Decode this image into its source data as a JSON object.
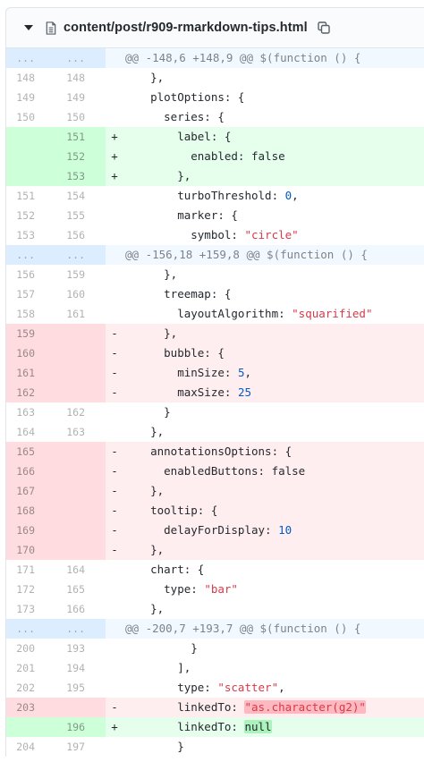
{
  "file": {
    "path": "content/post/r909-rmarkdown-tips.html",
    "collapse_icon": "caret-down-icon",
    "type_icon": "file-code-icon",
    "copy_icon": "copy-icon"
  },
  "colors": {
    "added_bg": "#e6ffed",
    "added_num_bg": "#cdffd8",
    "deleted_bg": "#ffeef0",
    "deleted_num_bg": "#ffdce0",
    "hunk_bg": "#f1f8ff",
    "hunk_num_bg": "#dbedff"
  },
  "lines": [
    {
      "type": "hunk",
      "old": "...",
      "new": "...",
      "sign": "",
      "parts": [
        {
          "t": "@@ -148,6 +148,9 @@ $(function () {",
          "c": ""
        }
      ]
    },
    {
      "type": "ctx",
      "old": "148",
      "new": "148",
      "sign": "",
      "parts": [
        {
          "t": "    },",
          "c": ""
        }
      ]
    },
    {
      "type": "ctx",
      "old": "149",
      "new": "149",
      "sign": "",
      "parts": [
        {
          "t": "    plotOptions: {",
          "c": ""
        }
      ]
    },
    {
      "type": "ctx",
      "old": "150",
      "new": "150",
      "sign": "",
      "parts": [
        {
          "t": "      series: {",
          "c": ""
        }
      ]
    },
    {
      "type": "add",
      "old": "",
      "new": "151",
      "sign": "+",
      "parts": [
        {
          "t": "        label: {",
          "c": ""
        }
      ]
    },
    {
      "type": "add",
      "old": "",
      "new": "152",
      "sign": "+",
      "parts": [
        {
          "t": "          enabled: ",
          "c": ""
        },
        {
          "t": "false",
          "c": "t-kw"
        }
      ]
    },
    {
      "type": "add",
      "old": "",
      "new": "153",
      "sign": "+",
      "parts": [
        {
          "t": "        },",
          "c": ""
        }
      ]
    },
    {
      "type": "ctx",
      "old": "151",
      "new": "154",
      "sign": "",
      "parts": [
        {
          "t": "        turboThreshold: ",
          "c": ""
        },
        {
          "t": "0",
          "c": "t-num"
        },
        {
          "t": ",",
          "c": ""
        }
      ]
    },
    {
      "type": "ctx",
      "old": "152",
      "new": "155",
      "sign": "",
      "parts": [
        {
          "t": "        marker: {",
          "c": ""
        }
      ]
    },
    {
      "type": "ctx",
      "old": "153",
      "new": "156",
      "sign": "",
      "parts": [
        {
          "t": "          symbol: ",
          "c": ""
        },
        {
          "t": "\"circle\"",
          "c": "t-str"
        }
      ]
    },
    {
      "type": "hunk",
      "old": "...",
      "new": "...",
      "sign": "",
      "parts": [
        {
          "t": "@@ -156,18 +159,8 @@ $(function () {",
          "c": ""
        }
      ]
    },
    {
      "type": "ctx",
      "old": "156",
      "new": "159",
      "sign": "",
      "parts": [
        {
          "t": "      },",
          "c": ""
        }
      ]
    },
    {
      "type": "ctx",
      "old": "157",
      "new": "160",
      "sign": "",
      "parts": [
        {
          "t": "      treemap: {",
          "c": ""
        }
      ]
    },
    {
      "type": "ctx",
      "old": "158",
      "new": "161",
      "sign": "",
      "parts": [
        {
          "t": "        layoutAlgorithm: ",
          "c": ""
        },
        {
          "t": "\"squarified\"",
          "c": "t-str"
        }
      ]
    },
    {
      "type": "del",
      "old": "159",
      "new": "",
      "sign": "-",
      "parts": [
        {
          "t": "      },",
          "c": ""
        }
      ]
    },
    {
      "type": "del",
      "old": "160",
      "new": "",
      "sign": "-",
      "parts": [
        {
          "t": "      bubble: {",
          "c": ""
        }
      ]
    },
    {
      "type": "del",
      "old": "161",
      "new": "",
      "sign": "-",
      "parts": [
        {
          "t": "        minSize: ",
          "c": ""
        },
        {
          "t": "5",
          "c": "t-num"
        },
        {
          "t": ",",
          "c": ""
        }
      ]
    },
    {
      "type": "del",
      "old": "162",
      "new": "",
      "sign": "-",
      "parts": [
        {
          "t": "        maxSize: ",
          "c": ""
        },
        {
          "t": "25",
          "c": "t-num"
        }
      ]
    },
    {
      "type": "ctx",
      "old": "163",
      "new": "162",
      "sign": "",
      "parts": [
        {
          "t": "      }",
          "c": ""
        }
      ]
    },
    {
      "type": "ctx",
      "old": "164",
      "new": "163",
      "sign": "",
      "parts": [
        {
          "t": "    },",
          "c": ""
        }
      ]
    },
    {
      "type": "del",
      "old": "165",
      "new": "",
      "sign": "-",
      "parts": [
        {
          "t": "    annotationsOptions: {",
          "c": ""
        }
      ]
    },
    {
      "type": "del",
      "old": "166",
      "new": "",
      "sign": "-",
      "parts": [
        {
          "t": "      enabledButtons: ",
          "c": ""
        },
        {
          "t": "false",
          "c": "t-kw"
        }
      ]
    },
    {
      "type": "del",
      "old": "167",
      "new": "",
      "sign": "-",
      "parts": [
        {
          "t": "    },",
          "c": ""
        }
      ]
    },
    {
      "type": "del",
      "old": "168",
      "new": "",
      "sign": "-",
      "parts": [
        {
          "t": "    tooltip: {",
          "c": ""
        }
      ]
    },
    {
      "type": "del",
      "old": "169",
      "new": "",
      "sign": "-",
      "parts": [
        {
          "t": "      delayForDisplay: ",
          "c": ""
        },
        {
          "t": "10",
          "c": "t-num"
        }
      ]
    },
    {
      "type": "del",
      "old": "170",
      "new": "",
      "sign": "-",
      "parts": [
        {
          "t": "    },",
          "c": ""
        }
      ]
    },
    {
      "type": "ctx",
      "old": "171",
      "new": "164",
      "sign": "",
      "parts": [
        {
          "t": "    chart: {",
          "c": ""
        }
      ]
    },
    {
      "type": "ctx",
      "old": "172",
      "new": "165",
      "sign": "",
      "parts": [
        {
          "t": "      type: ",
          "c": ""
        },
        {
          "t": "\"bar\"",
          "c": "t-str"
        }
      ]
    },
    {
      "type": "ctx",
      "old": "173",
      "new": "166",
      "sign": "",
      "parts": [
        {
          "t": "    },",
          "c": ""
        }
      ]
    },
    {
      "type": "hunk",
      "old": "...",
      "new": "...",
      "sign": "",
      "parts": [
        {
          "t": "@@ -200,7 +193,7 @@ $(function () {",
          "c": ""
        }
      ]
    },
    {
      "type": "ctx",
      "old": "200",
      "new": "193",
      "sign": "",
      "parts": [
        {
          "t": "          }",
          "c": ""
        }
      ]
    },
    {
      "type": "ctx",
      "old": "201",
      "new": "194",
      "sign": "",
      "parts": [
        {
          "t": "        ],",
          "c": ""
        }
      ]
    },
    {
      "type": "ctx",
      "old": "202",
      "new": "195",
      "sign": "",
      "parts": [
        {
          "t": "        type: ",
          "c": ""
        },
        {
          "t": "\"scatter\"",
          "c": "t-str"
        },
        {
          "t": ",",
          "c": ""
        }
      ]
    },
    {
      "type": "del",
      "old": "203",
      "new": "",
      "sign": "-",
      "parts": [
        {
          "t": "        linkedTo: ",
          "c": ""
        },
        {
          "t": "\"as.character(g2)\"",
          "c": "t-str x-str-del"
        }
      ]
    },
    {
      "type": "add",
      "old": "",
      "new": "196",
      "sign": "+",
      "parts": [
        {
          "t": "        linkedTo: ",
          "c": ""
        },
        {
          "t": "null",
          "c": "t-kw x-kw-add"
        }
      ]
    },
    {
      "type": "ctx",
      "old": "204",
      "new": "197",
      "sign": "",
      "parts": [
        {
          "t": "        }",
          "c": ""
        }
      ]
    }
  ]
}
